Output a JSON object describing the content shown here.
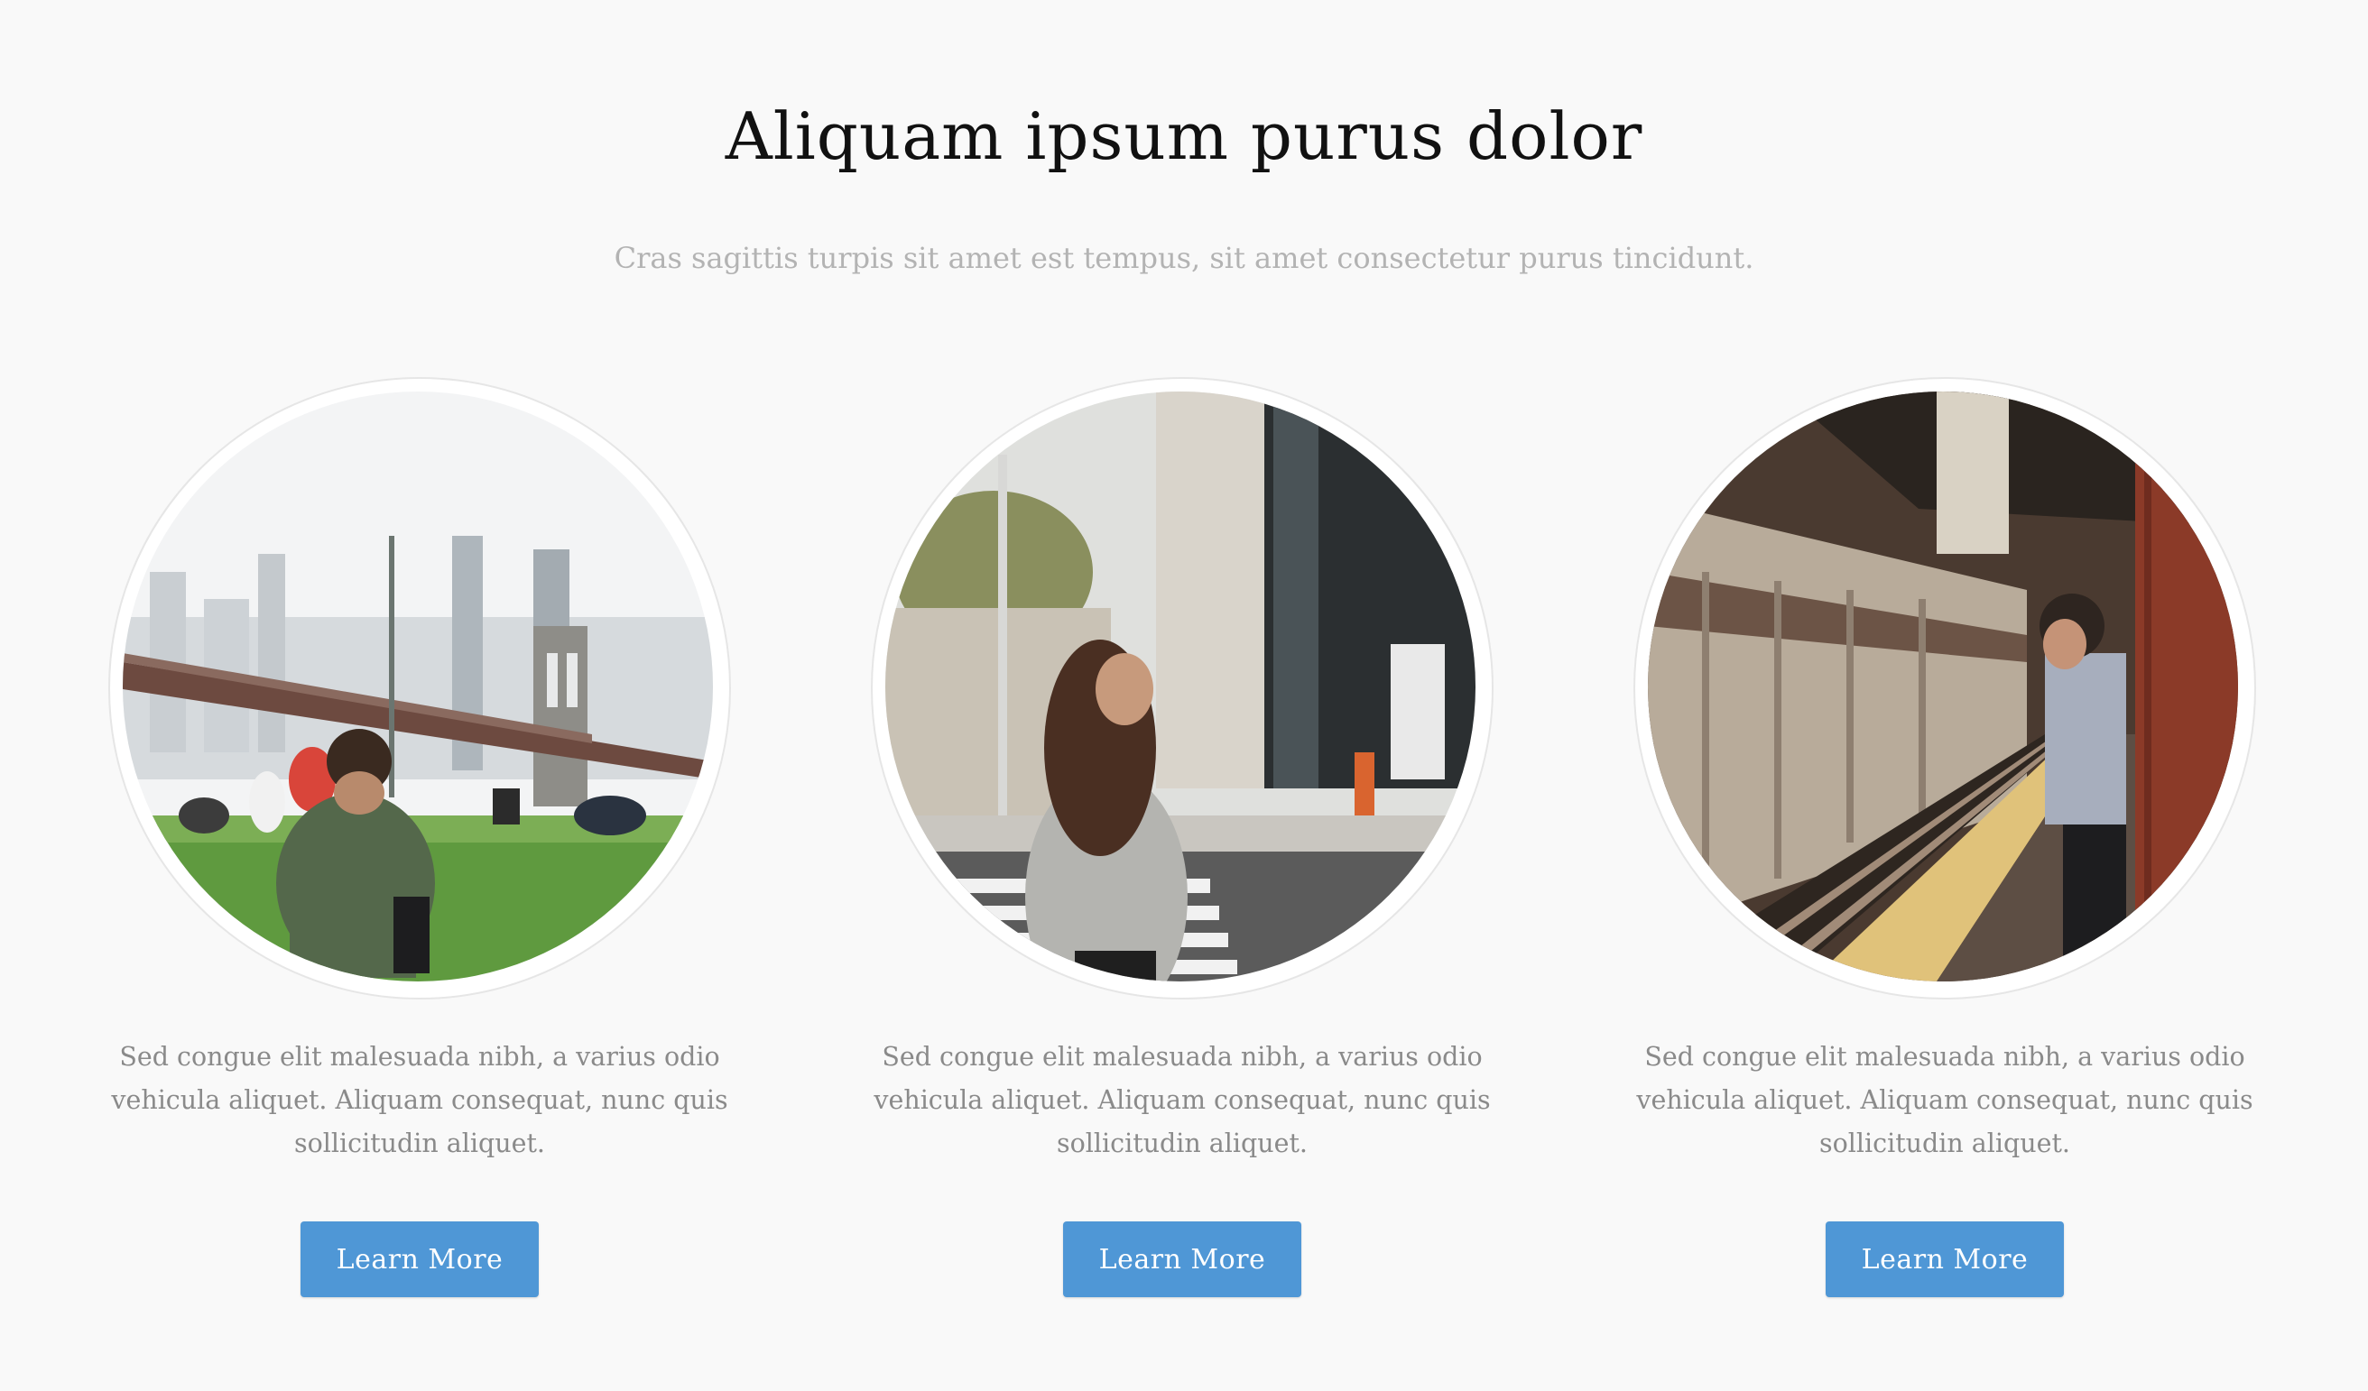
{
  "header": {
    "title": "Aliquam ipsum purus dolor",
    "subtitle": "Cras sagittis turpis sit amet est tempus, sit amet consectetur purus tincidunt."
  },
  "cards": [
    {
      "image": "park-bridge-photo",
      "text": "Sed congue elit malesuada nibh, a varius odio vehicula aliquet. Aliquam consequat, nunc quis sollicitudin aliquet.",
      "button_label": "Learn More"
    },
    {
      "image": "street-crosswalk-photo",
      "text": "Sed congue elit malesuada nibh, a varius odio vehicula aliquet. Aliquam consequat, nunc quis sollicitudin aliquet.",
      "button_label": "Learn More"
    },
    {
      "image": "subway-platform-photo",
      "text": "Sed congue elit malesuada nibh, a varius odio vehicula aliquet. Aliquam consequat, nunc quis sollicitudin aliquet.",
      "button_label": "Learn More"
    }
  ],
  "colors": {
    "background": "#f9f9f9",
    "title": "#111111",
    "subtitle": "#b3b3b3",
    "body_text": "#8a8a8a",
    "button": "#4f97d6",
    "button_text": "#ffffff"
  }
}
